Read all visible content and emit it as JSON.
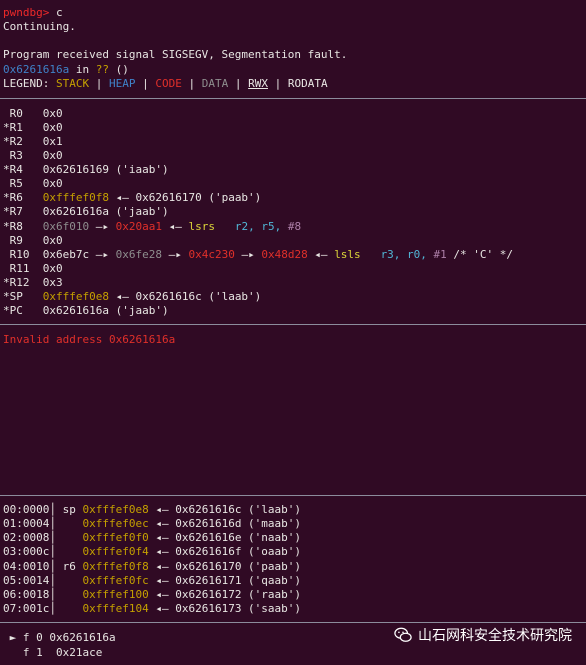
{
  "prompt": {
    "label": "pwndbg>",
    "cmd": " c"
  },
  "continuing": "Continuing.",
  "signal": "Program received signal SIGSEGV, Segmentation fault.",
  "location": {
    "addr": "0x6261616a",
    "in": " in ",
    "func": "??",
    "args": " ()"
  },
  "legend": {
    "label": "LEGEND: ",
    "stack": "STACK",
    "sep": " | ",
    "heap": "HEAP",
    "code": "CODE",
    "data": "DATA",
    "rwx": "RWX",
    "rodata": "RODATA"
  },
  "registers": [
    {
      "name": " R0 ",
      "value": "0x0"
    },
    {
      "name": "*R1 ",
      "value": "0x0"
    },
    {
      "name": "*R2 ",
      "value": "0x1"
    },
    {
      "name": " R3 ",
      "value": "0x0"
    },
    {
      "name": "*R4 ",
      "value": "0x62616169 ('iaab')"
    },
    {
      "name": " R5 ",
      "value": "0x0"
    },
    {
      "name": "*R6 ",
      "ptr": "0xfffef0f8",
      "rest": " ◂— 0x62616170 ('paab')"
    },
    {
      "name": "*R7 ",
      "value": "0x6261616a ('jaab')"
    },
    {
      "name": "*R8 ",
      "p1": "0x6f010",
      "arrow": " —▸ ",
      "p2": "0x20aa1",
      "arrow2": " ◂— ",
      "ins": "lsrs",
      "ops": "r2, r5, ",
      "imm": "#8"
    },
    {
      "name": " R9 ",
      "value": "0x0"
    },
    {
      "name": " R10",
      "v1": "0x6eb7c",
      "a1": " —▸ ",
      "v2": "0x6fe28",
      "a2": " —▸ ",
      "v3": "0x4c230",
      "a3": " —▸ ",
      "v4": "0x48d28",
      "a4": " ◂— ",
      "ins": "lsls",
      "ops": "r3, r0, ",
      "imm": "#1",
      "cmt": " /* 'C' */"
    },
    {
      "name": " R11",
      "value": "0x0"
    },
    {
      "name": "*R12",
      "value": "0x3"
    },
    {
      "name": "*SP ",
      "ptr": "0xfffef0e8",
      "rest": " ◂— 0x6261616c ('laab')"
    },
    {
      "name": "*PC ",
      "value": "0x6261616a ('jaab')"
    }
  ],
  "disasm_error": "Invalid address 0x6261616a",
  "stack": [
    {
      "off": "00:0000",
      "reg": "sp",
      "addr": "0xfffef0e8",
      "val": "◂— 0x6261616c ('laab')"
    },
    {
      "off": "01:0004",
      "reg": "  ",
      "addr": "0xfffef0ec",
      "val": "◂— 0x6261616d ('maab')"
    },
    {
      "off": "02:0008",
      "reg": "  ",
      "addr": "0xfffef0f0",
      "val": "◂— 0x6261616e ('naab')"
    },
    {
      "off": "03:000c",
      "reg": "  ",
      "addr": "0xfffef0f4",
      "val": "◂— 0x6261616f ('oaab')"
    },
    {
      "off": "04:0010",
      "reg": "r6",
      "addr": "0xfffef0f8",
      "val": "◂— 0x62616170 ('paab')"
    },
    {
      "off": "05:0014",
      "reg": "  ",
      "addr": "0xfffef0fc",
      "val": "◂— 0x62616171 ('qaab')"
    },
    {
      "off": "06:0018",
      "reg": "  ",
      "addr": "0xfffef100",
      "val": "◂— 0x62616172 ('raab')"
    },
    {
      "off": "07:001c",
      "reg": "  ",
      "addr": "0xfffef104",
      "val": "◂— 0x62616173 ('saab')"
    }
  ],
  "backtrace": [
    {
      "mark": " ► ",
      "frame": "f 0",
      "addr": " 0x6261616a"
    },
    {
      "mark": "   ",
      "frame": "f 1",
      "addr": "  0x21ace"
    }
  ],
  "watermark": "山石网科安全技术研究院",
  "colors": {
    "bg": "#300a24",
    "red": "#e0302a",
    "yellow": "#c4a000",
    "blue": "#3f82c8"
  }
}
